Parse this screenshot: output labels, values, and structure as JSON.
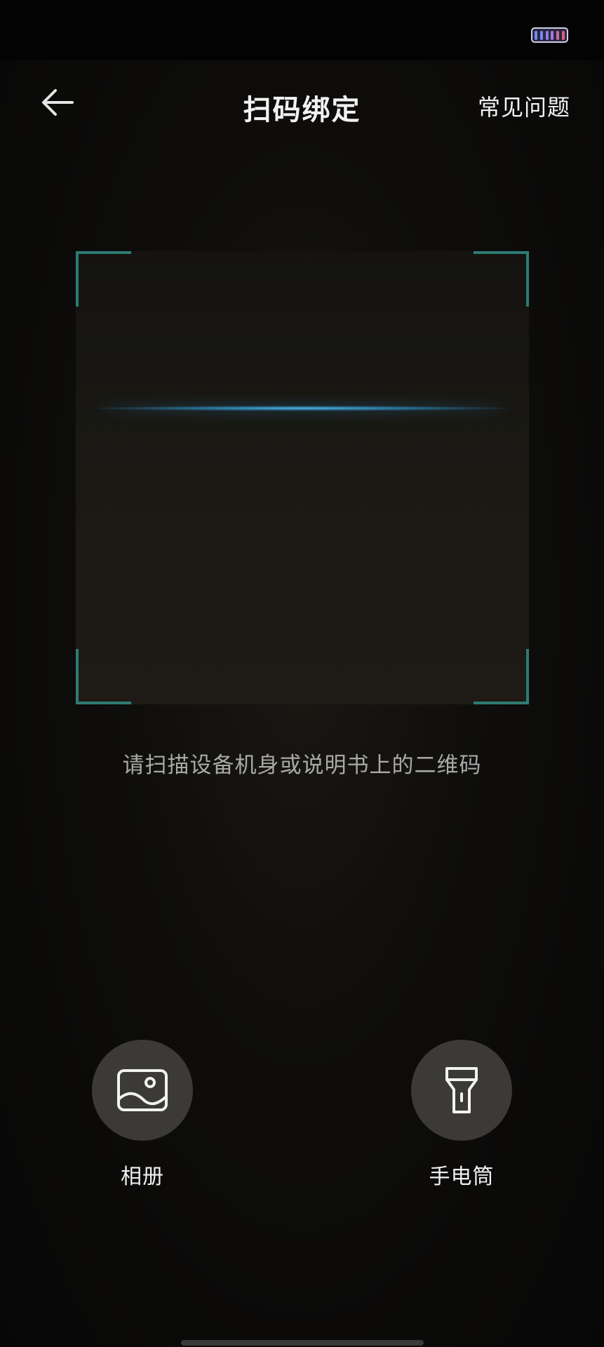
{
  "header": {
    "title": "扫码绑定",
    "faq_label": "常见问题"
  },
  "scanner": {
    "hint": "请扫描设备机身或说明书上的二维码"
  },
  "tools": {
    "album_label": "相册",
    "flashlight_label": "手电筒"
  },
  "icons": {
    "back": "arrow-left-icon",
    "album": "image-icon",
    "flashlight": "flashlight-icon",
    "battery": "battery-icon"
  },
  "colors": {
    "corner_accent": "#2d7b74",
    "scan_line": "#4fb3e0",
    "tool_button_bg": "#3b3a37"
  }
}
